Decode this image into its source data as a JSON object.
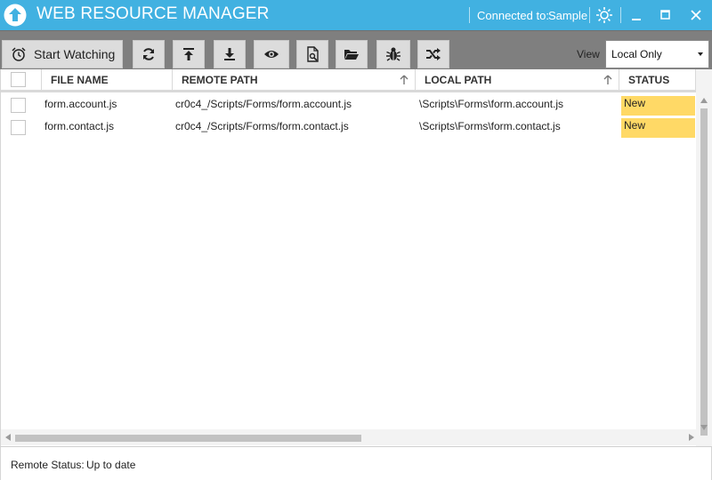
{
  "titlebar": {
    "title": "WEB RESOURCE MANAGER",
    "connected_label": "Connected to:",
    "connected_name": "Sample",
    "accent_color": "#41b1e1",
    "icons": [
      "upload-circle-icon",
      "gear-icon",
      "minimize-icon",
      "maximize-icon",
      "close-icon"
    ]
  },
  "toolbar": {
    "start_watching_label": "Start Watching",
    "buttons": [
      "alarm-clock-icon",
      "refresh-icon",
      "upload-to-top-icon",
      "download-icon",
      "eye-icon",
      "compare-file-icon",
      "open-folder-icon",
      "bug-icon",
      "shuffle-icon"
    ],
    "view_label": "View",
    "view_selected": "Local Only"
  },
  "grid": {
    "columns": [
      "FILE NAME",
      "REMOTE PATH",
      "LOCAL PATH",
      "STATUS"
    ],
    "rows": [
      {
        "file_name": "form.account.js",
        "remote_path": "cr0c4_/Scripts/Forms/form.account.js",
        "local_path": "\\Scripts\\Forms\\form.account.js",
        "status": "New"
      },
      {
        "file_name": "form.contact.js",
        "remote_path": "cr0c4_/Scripts/Forms/form.contact.js",
        "local_path": "\\Scripts\\Forms\\form.contact.js",
        "status": "New"
      }
    ],
    "status_new_color": "#ffd966"
  },
  "statusbar": {
    "label": "Remote Status:",
    "value": "Up to date"
  }
}
